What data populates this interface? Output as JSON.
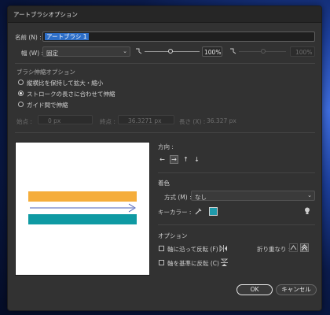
{
  "dialog": {
    "title": "アートブラシオプション",
    "name_label": "名前 (N) :",
    "name_value": "アートブラシ 1",
    "width_label": "幅 (W) :",
    "width_mode": "固定",
    "width_percent": "100%",
    "width_percent_right": "100%",
    "scale_section": "ブラシ伸縮オプション",
    "scale_options": [
      {
        "label": "縦横比を保持して拡大・縮小",
        "selected": false
      },
      {
        "label": "ストロークの長さに合わせて伸縮",
        "selected": true
      },
      {
        "label": "ガイド間で伸縮",
        "selected": false
      }
    ],
    "guides": {
      "start_label": "始点 :",
      "start_value": "0 px",
      "end_label": "終点 :",
      "end_value": "36.3271 px",
      "length_label": "長さ (X) :",
      "length_value": "36.327 px"
    },
    "direction": {
      "section": "方向 :",
      "arrows": [
        "←",
        "→",
        "↑",
        "↓"
      ],
      "selected_index": 1
    },
    "colorization": {
      "section": "着色",
      "method_label": "方式 (M) :",
      "method_value": "なし",
      "key_color_label": "キーカラー :",
      "key_color": "#1f9aab",
      "eyedropper_icon": "eyedropper-icon",
      "tip_icon": "lightbulb-icon"
    },
    "options": {
      "section": "オプション",
      "flip_along": "軸に沿って反転 (F)",
      "flip_across": "軸を基準に反転 (C)",
      "overlap_label": "折り重なり :"
    },
    "buttons": {
      "ok": "OK",
      "cancel": "キャンセル"
    },
    "preview": {
      "top_bar_color": "#f5ad3b",
      "bottom_bar_color": "#0f9aa3",
      "arrow_color": "#4a5fb8"
    }
  }
}
